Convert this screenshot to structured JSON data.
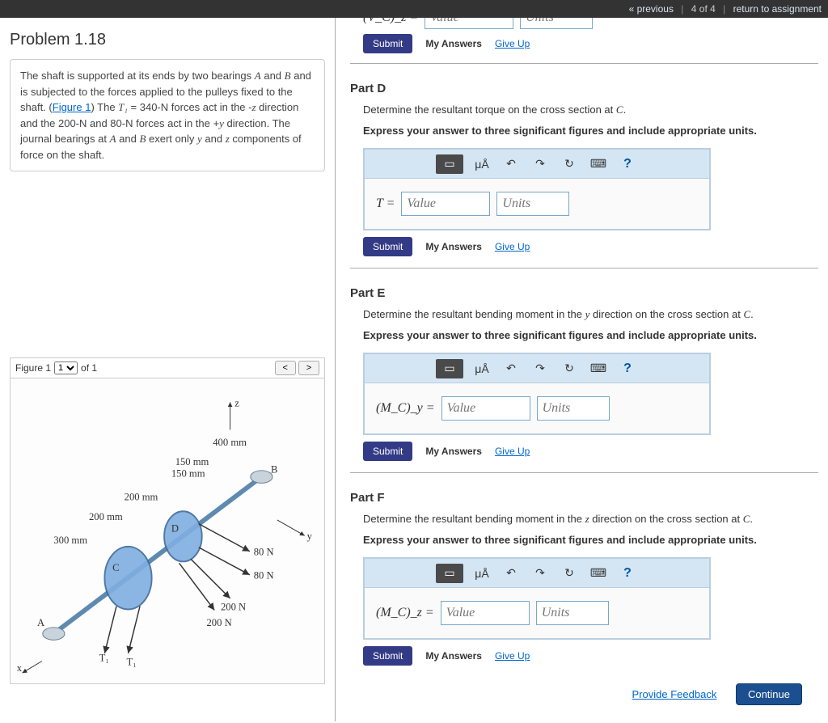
{
  "topnav": {
    "previous": "« previous",
    "position": "4 of 4",
    "return": "return to assignment"
  },
  "problem_title": "Problem 1.18",
  "description": {
    "t1": "The shaft is supported at its ends by two bearings ",
    "A": "A",
    "and1": " and ",
    "B": "B",
    "t2": " and is subjected to the forces applied to the pulleys fixed to the shaft. (",
    "figlink": "Figure 1",
    "t3": ") The ",
    "T1": "T₁",
    "eq": " = 340-N",
    "t4": " forces act in the -",
    "z": "z",
    "t5": " direction and the 200-N and 80-N forces act in the +",
    "y": "y",
    "t6": " direction. The journal bearings at ",
    "A2": "A",
    "and2": " and ",
    "B2": "B",
    "t7": " exert only ",
    "y2": "y",
    "and3": " and ",
    "z2": "z",
    "t8": " components of force on the shaft."
  },
  "figure": {
    "label": "Figure 1",
    "of": "of 1",
    "dims": {
      "d400": "400 mm",
      "d150a": "150 mm",
      "d150b": "150 mm",
      "d200a": "200 mm",
      "d200b": "200 mm",
      "d300": "300 mm",
      "f80a": "80 N",
      "f80b": "80 N",
      "f200a": "200 N",
      "f200b": "200 N",
      "T1a": "T₁",
      "T1b": "T₁",
      "ptA": "A",
      "ptB": "B",
      "ptC": "C",
      "ptD": "D",
      "axX": "x",
      "axY": "y",
      "axZ": "z"
    }
  },
  "partialC": {
    "lhs": "(V_C)_z =",
    "value_ph": "Value",
    "units_ph": "Units"
  },
  "partD": {
    "title": "Part D",
    "desc_pre": "Determine the resultant torque on the cross section at ",
    "C": "C",
    "dot": ".",
    "instr": "Express your answer to three significant figures and include appropriate units.",
    "lhs": "T =",
    "value_ph": "Value",
    "units_ph": "Units"
  },
  "partE": {
    "title": "Part E",
    "desc_pre": "Determine the resultant bending moment in the ",
    "y": "y",
    "desc_mid": " direction on the cross section at ",
    "C": "C",
    "dot": ".",
    "instr": "Express your answer to three significant figures and include appropriate units.",
    "lhs": "(M_C)_y =",
    "value_ph": "Value",
    "units_ph": "Units"
  },
  "partF": {
    "title": "Part F",
    "desc_pre": "Determine the resultant bending moment in the ",
    "z": "z",
    "desc_mid": " direction on the cross section at ",
    "C": "C",
    "dot": ".",
    "instr": "Express your answer to three significant figures and include appropriate units.",
    "lhs": "(M_C)_z =",
    "value_ph": "Value",
    "units_ph": "Units"
  },
  "toolbar": {
    "fmt": "▭",
    "muA": "μÅ",
    "undo": "↶",
    "redo": "↷",
    "reset": "↻",
    "kbd": "⌨",
    "help": "?"
  },
  "buttons": {
    "submit": "Submit",
    "my_answers": "My Answers",
    "give_up": "Give Up",
    "feedback": "Provide Feedback",
    "continue": "Continue"
  }
}
